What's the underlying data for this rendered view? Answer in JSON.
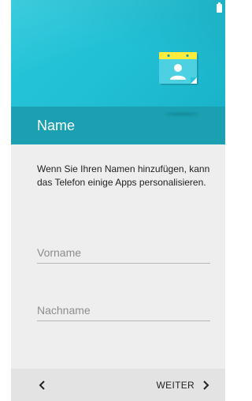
{
  "header": {
    "title": "Name"
  },
  "main": {
    "description": "Wenn Sie Ihren Namen hinzufügen, kann das Telefon einige Apps personalisieren.",
    "first_name": {
      "placeholder": "Vorname",
      "value": ""
    },
    "last_name": {
      "placeholder": "Nachname",
      "value": ""
    }
  },
  "footer": {
    "back_icon": "chevron-left-icon",
    "next_label": "WEITER",
    "next_icon": "chevron-right-icon"
  },
  "colors": {
    "hero": "#26c6da",
    "title_bar": "#1aa0b1",
    "card_tab": "#ffeb3b",
    "background": "#eeeeee",
    "bottom_bar": "#e3e3e3"
  },
  "icons": {
    "hero": "contact-card-icon",
    "status": "battery-icon"
  }
}
